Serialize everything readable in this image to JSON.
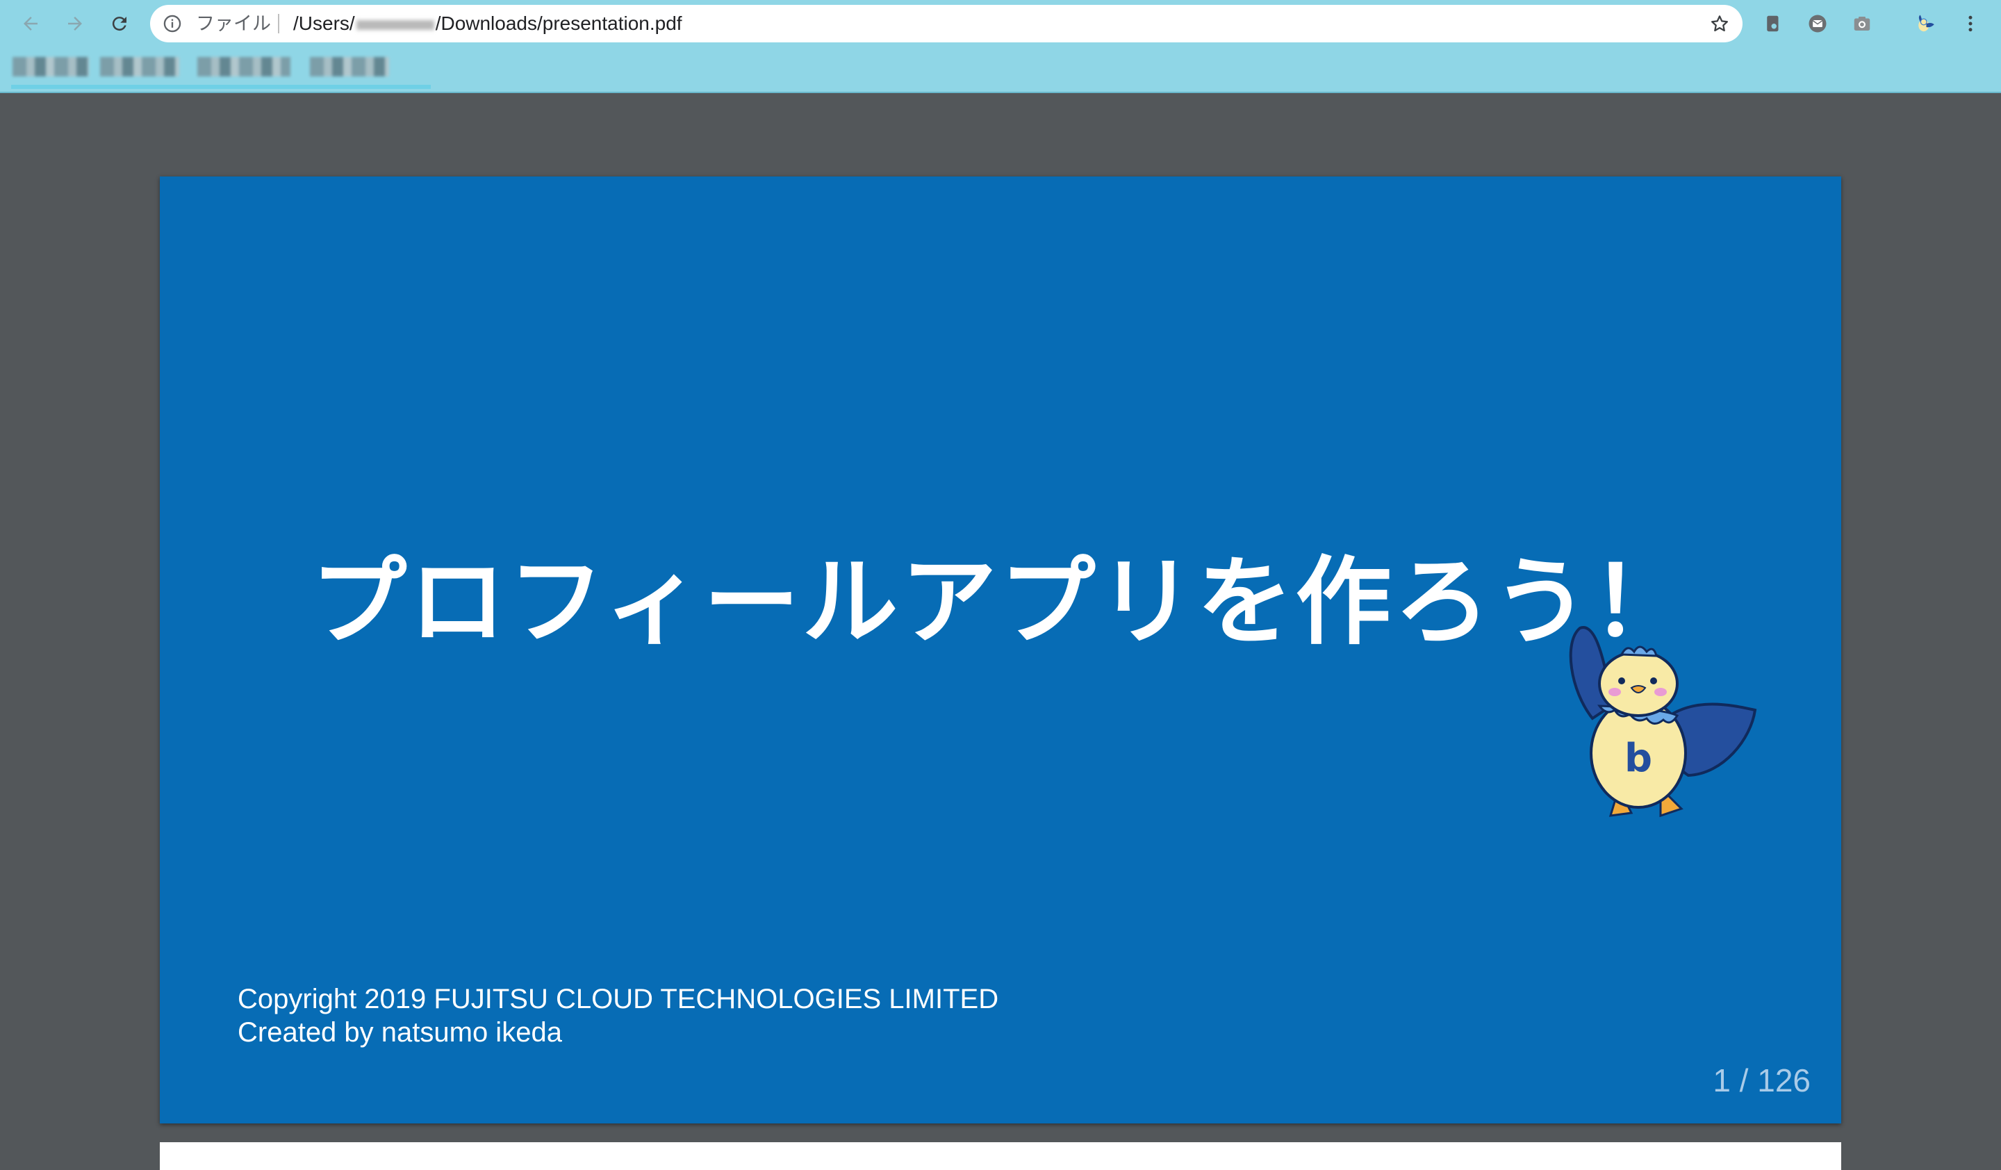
{
  "browser": {
    "scheme_label": "ファイル",
    "url_prefix": "/Users/",
    "url_suffix": "/Downloads/presentation.pdf"
  },
  "icons": {
    "back": "back-arrow-icon",
    "forward": "forward-arrow-icon",
    "reload": "reload-icon",
    "info": "info-icon",
    "star": "star-icon",
    "menu": "kebab-menu-icon"
  },
  "slide": {
    "title": "プロフィールアプリを作ろう！",
    "copyright_line1": "Copyright 2019 FUJITSU CLOUD TECHNOLOGIES LIMITED",
    "copyright_line2": "Created by natsumo ikeda",
    "page_counter": "1 / 126"
  },
  "colors": {
    "toolbar": "#8fd6e6",
    "slide_background": "#076cb5",
    "viewer_background": "#53575a"
  }
}
